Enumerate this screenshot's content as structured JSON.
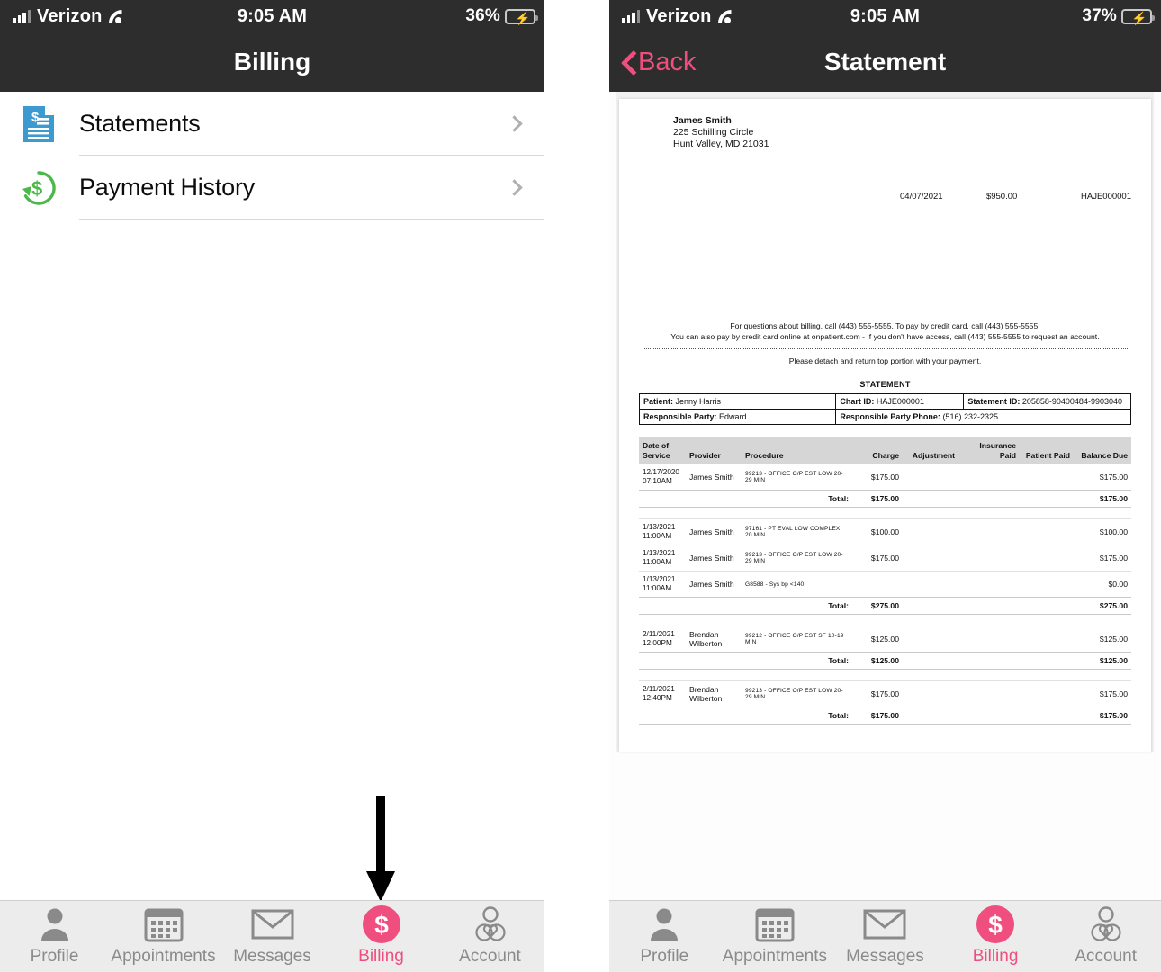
{
  "left": {
    "status": {
      "carrier": "Verizon",
      "time": "9:05 AM",
      "battery": "36%",
      "wifi_icon": "wifi-icon",
      "signal_icon": "signal-bars-icon",
      "battery_icon": "battery-charging-icon"
    },
    "nav": {
      "title": "Billing"
    },
    "list": [
      {
        "label": "Statements",
        "icon": "document-dollar-icon",
        "chevron": "chevron-right-icon"
      },
      {
        "label": "Payment History",
        "icon": "refresh-dollar-icon",
        "chevron": "chevron-right-icon"
      }
    ],
    "annotation": {
      "icon": "down-arrow-annotation",
      "points_to": "Billing"
    }
  },
  "right": {
    "status": {
      "carrier": "Verizon",
      "time": "9:05 AM",
      "battery": "37%",
      "wifi_icon": "wifi-icon",
      "signal_icon": "signal-bars-icon",
      "battery_icon": "battery-charging-icon"
    },
    "nav": {
      "title": "Statement",
      "back_label": "Back",
      "back_icon": "chevron-left-icon"
    },
    "statement": {
      "sender": {
        "name": "James Smith",
        "street": "225 Schilling Circle",
        "city_state_zip": "Hunt Valley, MD 21031"
      },
      "summary": {
        "date": "04/07/2021",
        "amount": "$950.00",
        "account": "HAJE000001"
      },
      "notice_line1": "For questions about billing, call (443) 555-5555. To pay by credit card, call (443) 555-5555.",
      "notice_line2": "You can also pay by credit card online at onpatient.com - If you don't have access, call (443) 555-5555 to request an account.",
      "detach_note": "Please detach and return top portion with your payment.",
      "section_title": "STATEMENT",
      "info": {
        "patient_label": "Patient:",
        "patient_value": "Jenny Harris",
        "chart_label": "Chart ID:",
        "chart_value": "HAJE000001",
        "statement_label": "Statement ID:",
        "statement_value": "205858-90400484-9903040",
        "resp_label": "Responsible Party:",
        "resp_value": "Edward",
        "resp_phone_label": "Responsible Party Phone:",
        "resp_phone_value": "(516) 232-2325"
      },
      "columns": [
        "Date of Service",
        "Provider",
        "Procedure",
        "Charge",
        "Adjustment",
        "Insurance Paid",
        "Patient Paid",
        "Balance Due"
      ],
      "total_label": "Total:",
      "groups": [
        {
          "rows": [
            {
              "date": "12/17/2020",
              "time": "07:10AM",
              "provider": "James Smith",
              "procedure": "99213 - OFFICE O/P EST LOW 20-29 MIN",
              "charge": "$175.00",
              "adjustment": "",
              "insurance_paid": "",
              "patient_paid": "",
              "balance_due": "$175.00"
            }
          ],
          "total_charge": "$175.00",
          "total_balance": "$175.00"
        },
        {
          "rows": [
            {
              "date": "1/13/2021",
              "time": "11:00AM",
              "provider": "James Smith",
              "procedure": "97161 - PT EVAL LOW COMPLEX 20 MIN",
              "charge": "$100.00",
              "adjustment": "",
              "insurance_paid": "",
              "patient_paid": "",
              "balance_due": "$100.00"
            },
            {
              "date": "1/13/2021",
              "time": "11:00AM",
              "provider": "James Smith",
              "procedure": "99213 - OFFICE O/P EST LOW 20-29 MIN",
              "charge": "$175.00",
              "adjustment": "",
              "insurance_paid": "",
              "patient_paid": "",
              "balance_due": "$175.00"
            },
            {
              "date": "1/13/2021",
              "time": "11:00AM",
              "provider": "James Smith",
              "procedure": "G8588 - Sys bp <140",
              "charge": "",
              "adjustment": "",
              "insurance_paid": "",
              "patient_paid": "",
              "balance_due": "$0.00"
            }
          ],
          "total_charge": "$275.00",
          "total_balance": "$275.00"
        },
        {
          "rows": [
            {
              "date": "2/11/2021",
              "time": "12:00PM",
              "provider": "Brendan Wilberton",
              "procedure": "99212 - OFFICE O/P EST SF 10-19 MIN",
              "charge": "$125.00",
              "adjustment": "",
              "insurance_paid": "",
              "patient_paid": "",
              "balance_due": "$125.00"
            }
          ],
          "total_charge": "$125.00",
          "total_balance": "$125.00"
        },
        {
          "rows": [
            {
              "date": "2/11/2021",
              "time": "12:40PM",
              "provider": "Brendan Wilberton",
              "procedure": "99213 - OFFICE O/P EST LOW 20-29 MIN",
              "charge": "$175.00",
              "adjustment": "",
              "insurance_paid": "",
              "patient_paid": "",
              "balance_due": "$175.00"
            }
          ],
          "total_charge": "$175.00",
          "total_balance": "$175.00"
        }
      ]
    }
  },
  "tabs": [
    {
      "label": "Profile",
      "icon": "person-icon",
      "active": false
    },
    {
      "label": "Appointments",
      "icon": "calendar-icon",
      "active": false
    },
    {
      "label": "Messages",
      "icon": "envelope-icon",
      "active": false
    },
    {
      "label": "Billing",
      "icon": "dollar-circle-icon",
      "active": true
    },
    {
      "label": "Account",
      "icon": "person-heart-icon",
      "active": true
    }
  ],
  "colors": {
    "accent_pink": "#ef4e7f",
    "navbar_dark": "#2d2d2d",
    "tabbar_bg": "#ececec",
    "inactive_gray": "#8a8a8a",
    "statements_blue": "#3d9ad1",
    "payment_green": "#4cb849",
    "battery_green": "#3ed35c"
  }
}
